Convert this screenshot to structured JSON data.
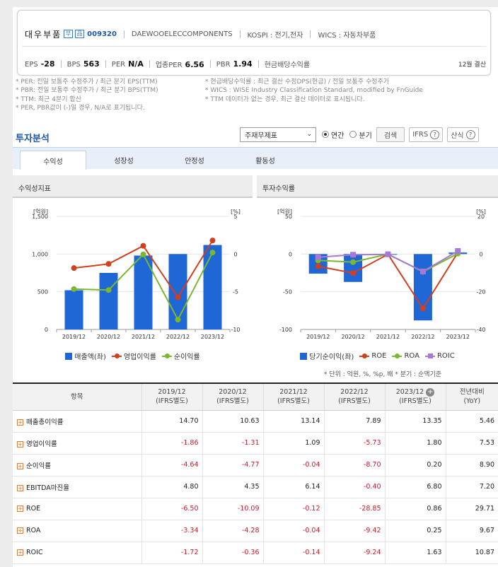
{
  "company": {
    "name": "대우부품",
    "icon1": "부",
    "icon2": "品",
    "code": "009320",
    "eng_name": "DAEWOOELECCOMPONENTS",
    "market": "KOSPI : 전기,전자",
    "wics": "WICS : 자동차부품",
    "metrics": [
      {
        "label": "EPS",
        "value": "-28"
      },
      {
        "label": "BPS",
        "value": "563"
      },
      {
        "label": "PER",
        "value": "N/A"
      },
      {
        "label": "업종PER",
        "value": "6.56"
      },
      {
        "label": "PBR",
        "value": "1.94"
      },
      {
        "label": "현금배당수익률",
        "value": ""
      }
    ],
    "settle": "12월 결산"
  },
  "notes": {
    "left": [
      "* PER: 전일 보통주 수정주가 / 최근 분기 EPS(TTM)",
      "* PBR: 전일 보통주 수정주가 / 최근 분기 BPS(TTM)",
      "* TTM: 최근 4분기 합산",
      "* PER, PBR값이 (-)일 경우, N/A로 표기됩니다."
    ],
    "right": [
      "* 현금배당수익률 : 최근 결산 수정DPS(현금) / 전일 보통주 수정주가",
      "* WICS : WISE Industry Classification Standard, modified by FnGuide",
      "* TTM 데이터가 없는 경우, 최근 결산 데이터로 표시됩니다."
    ]
  },
  "section_title": "투자분석",
  "controls": {
    "select_value": "주재무제표",
    "radio_annual": "연간",
    "radio_quarter": "분기",
    "search": "검색",
    "ifrs": "IFRS",
    "formula": "산식"
  },
  "tabs": [
    "수익성",
    "성장성",
    "안정성",
    "활동성"
  ],
  "panel_left_title": "수익성지표",
  "panel_right_title": "투자수익률",
  "chart_data": [
    {
      "type": "bar",
      "title": "수익성지표",
      "categories": [
        "2019/12",
        "2020/12",
        "2021/12",
        "2022/12",
        "2023/12"
      ],
      "left_unit": "[억원]",
      "right_unit": "[%]",
      "left_ylim": [
        0,
        1500
      ],
      "left_ticks": [
        "0",
        "500",
        "1,000",
        "1,500"
      ],
      "right_ylim": [
        -10,
        5
      ],
      "right_ticks": [
        "-10",
        "-5",
        "0",
        "5"
      ],
      "grid": true,
      "legend_position": "bottom",
      "series": [
        {
          "name": "매출액(좌)",
          "axis": "left",
          "kind": "bar",
          "color": "#1f66d6",
          "values": [
            520,
            750,
            980,
            1000,
            1120
          ]
        },
        {
          "name": "영업이익률",
          "axis": "right",
          "kind": "line",
          "color": "#d0401e",
          "values": [
            -1.86,
            -1.31,
            1.09,
            -5.73,
            1.8
          ]
        },
        {
          "name": "순이익률",
          "axis": "right",
          "kind": "line",
          "color": "#7ab82e",
          "values": [
            -4.64,
            -4.77,
            -0.04,
            -8.7,
            0.2
          ]
        }
      ]
    },
    {
      "type": "bar",
      "title": "투자수익률",
      "categories": [
        "2019/12",
        "2020/12",
        "2021/12",
        "2022/12",
        "2023/12"
      ],
      "left_unit": "[억원]",
      "right_unit": "[%]",
      "left_ylim": [
        -100,
        50
      ],
      "left_ticks": [
        "-100",
        "-50",
        "0",
        "50"
      ],
      "right_ylim": [
        -40,
        20
      ],
      "right_ticks": [
        "-40",
        "-20",
        "0",
        "20"
      ],
      "grid": true,
      "legend_position": "bottom",
      "series": [
        {
          "name": "당기순이익(좌)",
          "axis": "left",
          "kind": "bar",
          "color": "#1f66d6",
          "values": [
            -26,
            -37,
            0,
            -88,
            2
          ]
        },
        {
          "name": "ROE",
          "axis": "right",
          "kind": "line",
          "color": "#d0401e",
          "values": [
            -6.5,
            -10.09,
            -0.12,
            -28.85,
            0.86
          ]
        },
        {
          "name": "ROA",
          "axis": "right",
          "kind": "line",
          "color": "#7ab82e",
          "values": [
            -3.34,
            -4.28,
            -0.04,
            -9.42,
            0.25
          ]
        },
        {
          "name": "ROIC",
          "axis": "right",
          "kind": "line",
          "color": "#a57ad6",
          "marker": "square",
          "values": [
            -1.72,
            -0.36,
            -0.14,
            -9.24,
            1.63
          ]
        }
      ]
    }
  ],
  "unit_note": "* 단위 : 억원, %, %p, 배     * 분기 : 순액기준",
  "table": {
    "item_header": "항목",
    "columns": [
      {
        "year": "2019/12",
        "sub": "(IFRS별도)"
      },
      {
        "year": "2020/12",
        "sub": "(IFRS별도)"
      },
      {
        "year": "2021/12",
        "sub": "(IFRS별도)"
      },
      {
        "year": "2022/12",
        "sub": "(IFRS별도)"
      },
      {
        "year": "2023/12",
        "sub": "(IFRS별도)"
      },
      {
        "year": "전년대비",
        "sub": "(YoY)"
      }
    ],
    "rows": [
      {
        "label": "매출총이익률",
        "values": [
          "14.70",
          "10.63",
          "13.14",
          "7.89",
          "13.35",
          "5.46"
        ]
      },
      {
        "label": "영업이익률",
        "values": [
          "-1.86",
          "-1.31",
          "1.09",
          "-5.73",
          "1.80",
          "7.53"
        ]
      },
      {
        "label": "순이익률",
        "values": [
          "-4.64",
          "-4.77",
          "-0.04",
          "-8.70",
          "0.20",
          "8.90"
        ]
      },
      {
        "label": "EBITDA마진율",
        "values": [
          "4.80",
          "4.35",
          "6.14",
          "-0.40",
          "6.80",
          "7.20"
        ]
      },
      {
        "label": "ROE",
        "values": [
          "-6.50",
          "-10.09",
          "-0.12",
          "-28.85",
          "0.86",
          "29.71"
        ]
      },
      {
        "label": "ROA",
        "values": [
          "-3.34",
          "-4.28",
          "-0.04",
          "-9.42",
          "0.25",
          "9.67"
        ]
      },
      {
        "label": "ROIC",
        "values": [
          "-1.72",
          "-0.36",
          "-0.14",
          "-9.24",
          "1.63",
          "10.87"
        ]
      }
    ]
  }
}
